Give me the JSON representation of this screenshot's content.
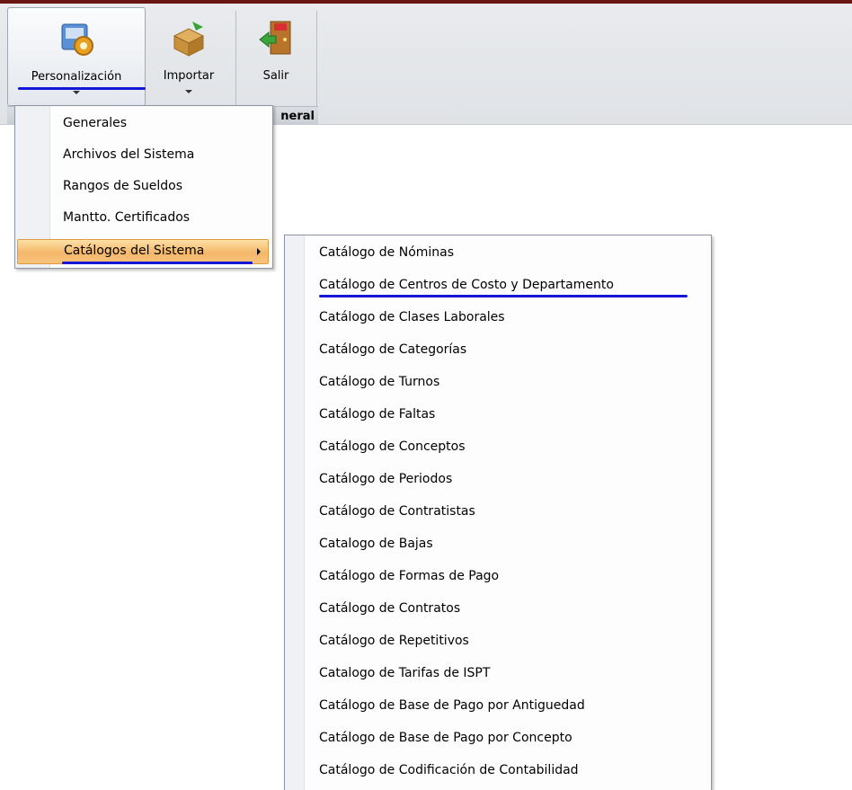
{
  "ribbon": {
    "buttons": [
      {
        "label": "Personalización",
        "icon": "gear-disk-icon"
      },
      {
        "label": "Importar",
        "icon": "import-box-icon"
      },
      {
        "label": "Salir",
        "icon": "exit-door-icon"
      }
    ],
    "group_label": "neral"
  },
  "menu": {
    "items": [
      {
        "label": "Generales"
      },
      {
        "label": "Archivos del Sistema"
      },
      {
        "label": "Rangos de Sueldos"
      },
      {
        "label": "Mantto. Certificados"
      },
      {
        "label": "Catálogos del Sistema"
      }
    ]
  },
  "submenu": {
    "items": [
      {
        "label": "Catálogo de Nóminas"
      },
      {
        "label": "Catálogo de Centros de Costo y Departamento"
      },
      {
        "label": "Catálogo de Clases Laborales"
      },
      {
        "label": "Catálogo de Categorías"
      },
      {
        "label": "Catálogo de Turnos"
      },
      {
        "label": "Catálogo de Faltas"
      },
      {
        "label": "Catálogo de Conceptos"
      },
      {
        "label": "Catálogo de Periodos"
      },
      {
        "label": "Catálogo de Contratistas"
      },
      {
        "label": "Catalogo de Bajas"
      },
      {
        "label": "Catálogo de Formas de Pago"
      },
      {
        "label": "Catálogo de Contratos"
      },
      {
        "label": "Catálogo de Repetitivos"
      },
      {
        "label": "Catalogo de Tarifas de ISPT"
      },
      {
        "label": "Catálogo de Base de Pago por Antiguedad"
      },
      {
        "label": "Catálogo de Base de Pago por Concepto"
      },
      {
        "label": "Catálogo de Codificación de Contabilidad"
      }
    ]
  },
  "colors": {
    "highlight": "#f4b76a",
    "annotation_underline": "#1416d8",
    "title_bar": "#6b1515"
  }
}
